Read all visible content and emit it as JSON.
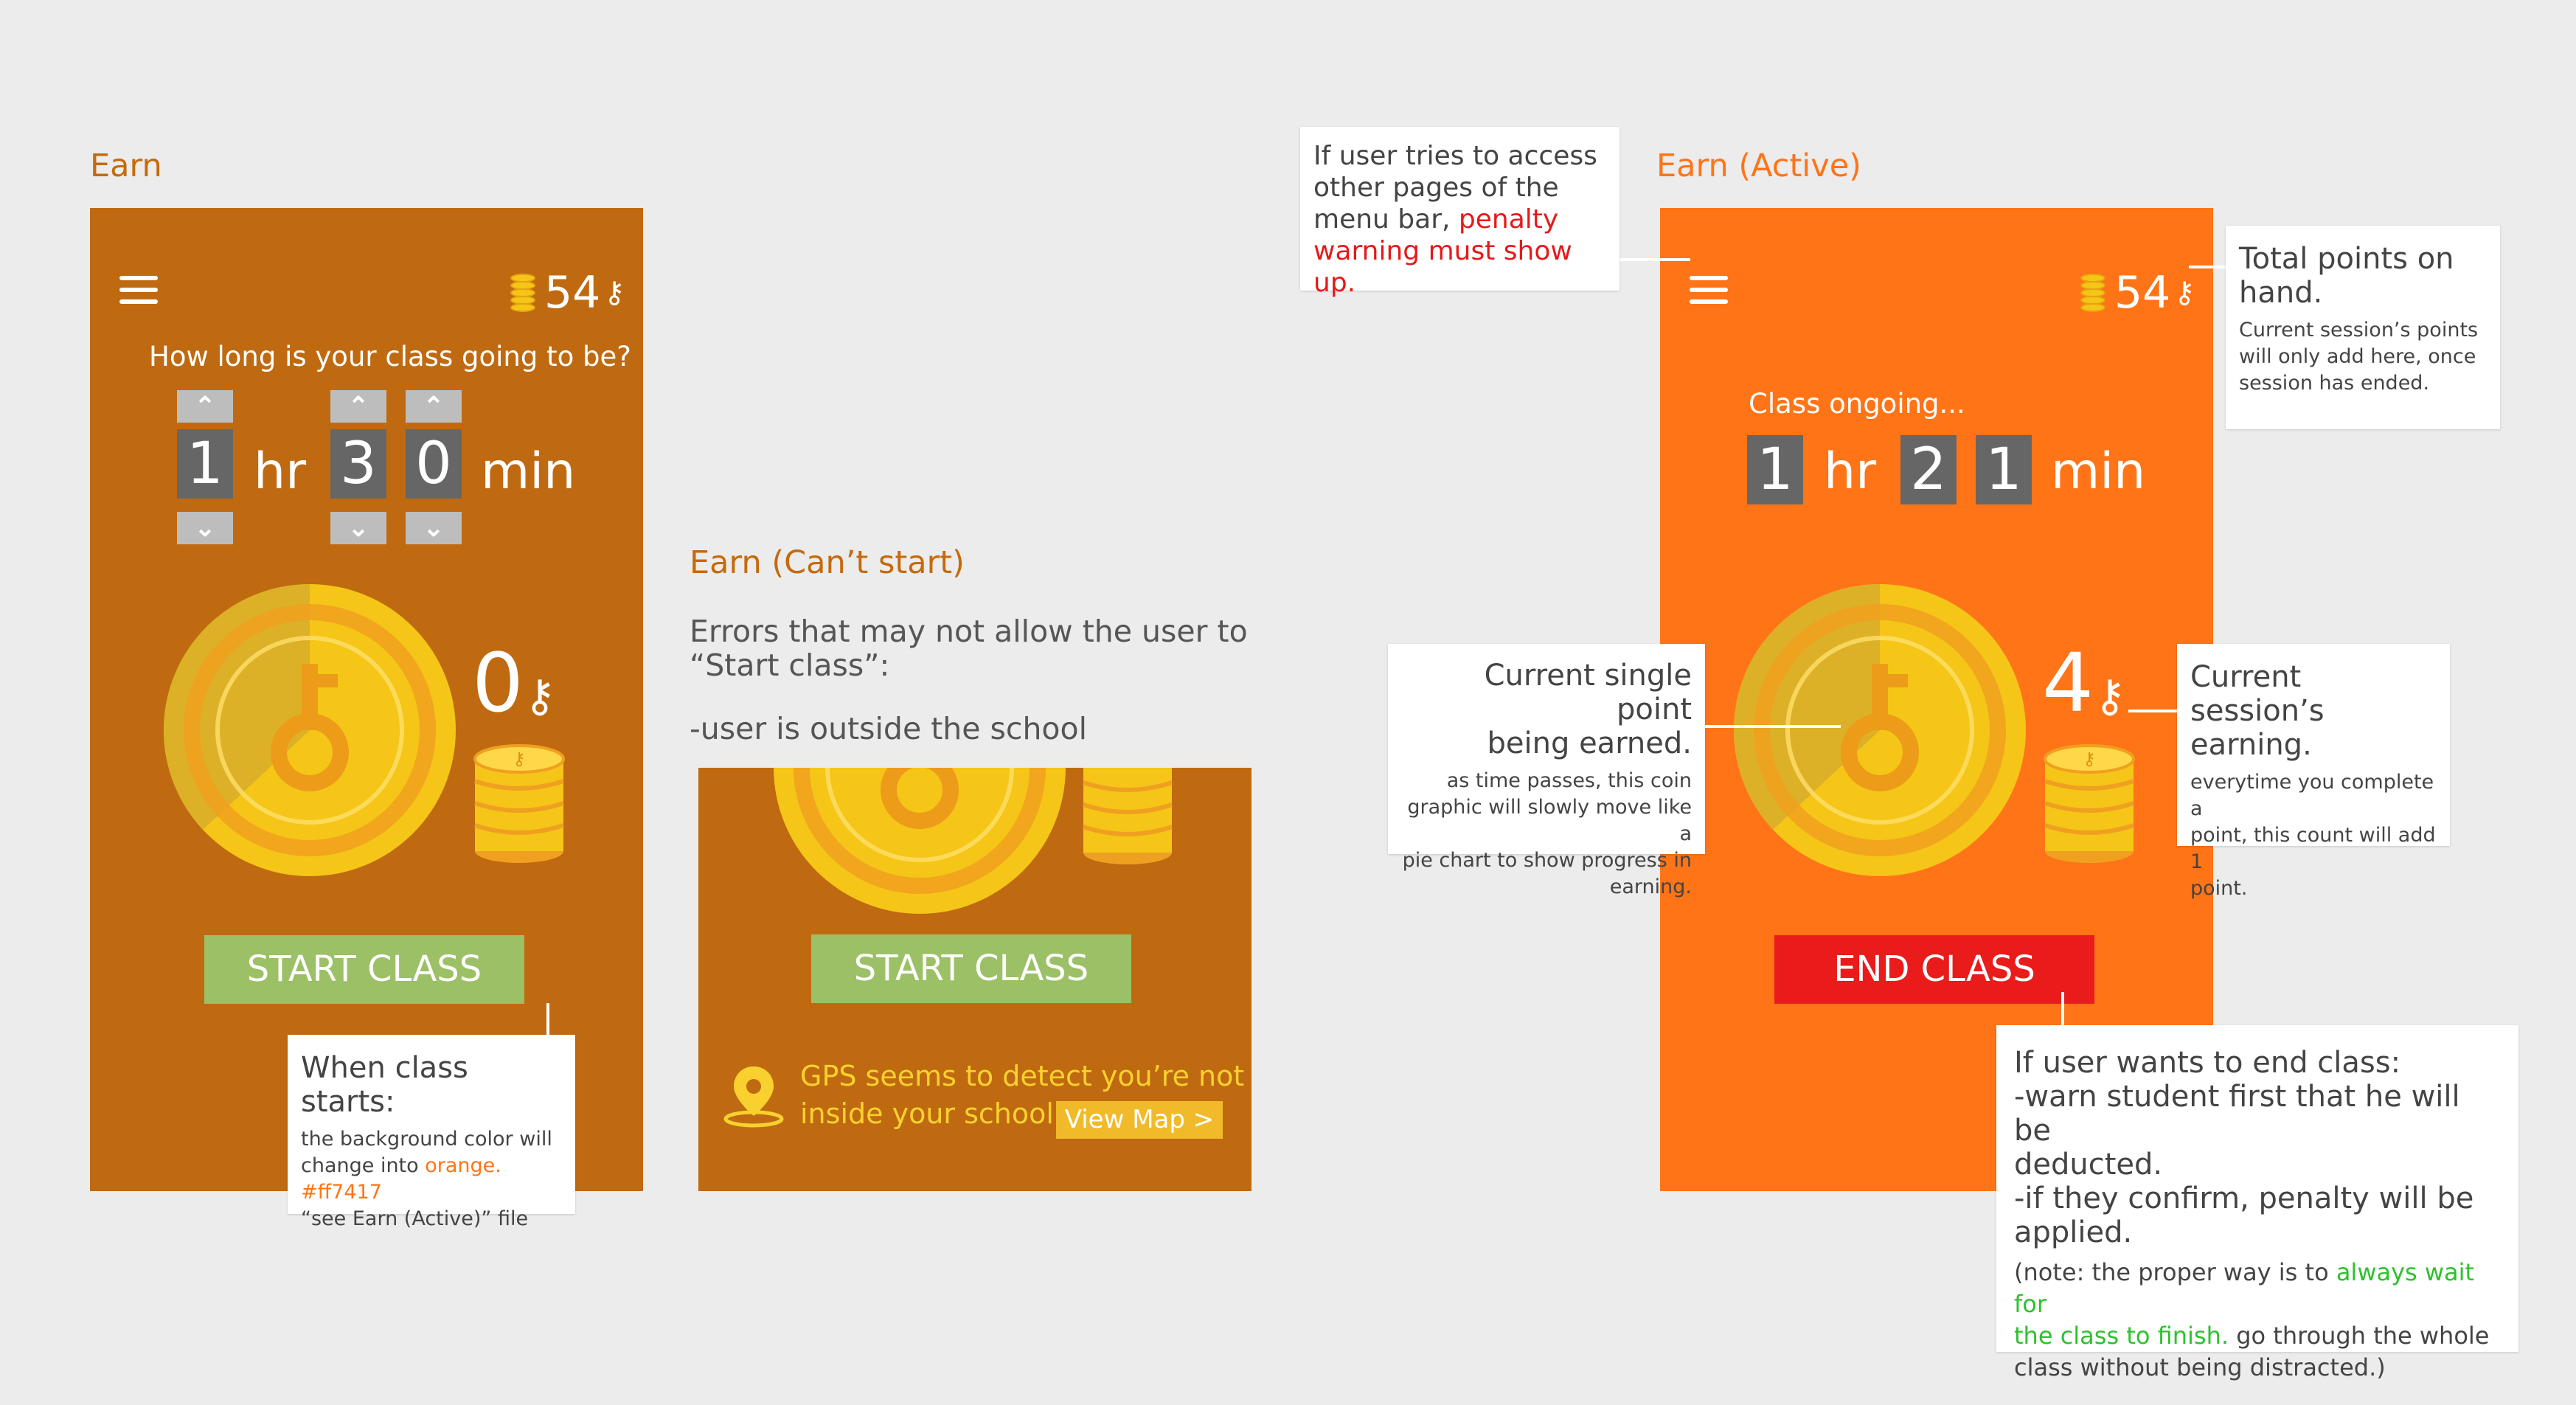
{
  "colors": {
    "earn_bg": "#bf6a11",
    "active_bg": "#ff7417",
    "start_button": "#9bc066",
    "end_button": "#ea1b1b",
    "title_orange": "#c56a0c",
    "title_bright": "#ff7417",
    "highlight_red": "#e51919",
    "highlight_green": "#2ec12e",
    "gps_yellow": "#f9d12e"
  },
  "earn": {
    "title": "Earn",
    "points": "54",
    "question": "How long is your class going to be?",
    "hours_digit": "1",
    "hours_unit": "hr",
    "min_digit_1": "3",
    "min_digit_2": "0",
    "min_unit": "min",
    "session_points": "0",
    "start_button": "START CLASS",
    "icons": [
      "menu-icon",
      "coin-stack-icon",
      "key-icon",
      "chevron-up-icon",
      "chevron-down-icon"
    ]
  },
  "cant_start": {
    "title": "Earn (Can’t start)",
    "desc_line1": "Errors that may not allow the user to",
    "desc_line2": "“Start class”:",
    "desc_line3": "-user is outside the school",
    "start_button": "START CLASS",
    "gps_line1": "GPS seems to detect you’re not",
    "gps_line2": "inside your school.",
    "view_map": "View Map >"
  },
  "active": {
    "title": "Earn (Active)",
    "points": "54",
    "status": "Class ongoing...",
    "hours_digit": "1",
    "hours_unit": "hr",
    "min_digit_1": "2",
    "min_digit_2": "1",
    "min_unit": "min",
    "session_points": "4",
    "end_button": "END CLASS"
  },
  "notes": {
    "class_starts": {
      "heading": "When class starts:",
      "line1": "the background color will",
      "line2_prefix": "change into ",
      "line2_highlight": "orange. #ff7417",
      "line3": "“see Earn (Active)” file"
    },
    "penalty": {
      "line1": "If user tries to access",
      "line2": "other pages of the",
      "line3_prefix": "menu bar, ",
      "line3_highlight": "penalty",
      "line4_highlight": "warning must show up."
    },
    "total_points": {
      "heading1": "Total points on",
      "heading2": "hand.",
      "line1": "Current session’s points",
      "line2": "will only add here, once",
      "line3": "session has ended."
    },
    "single_point": {
      "heading1": "Current single point",
      "heading2": "being earned.",
      "line1": "as time passes, this coin",
      "line2": "graphic will slowly move like a",
      "line3": "pie chart to show progress in",
      "line4": "earning."
    },
    "session_earning": {
      "heading1": "Current session’s",
      "heading2": "earning.",
      "line1": "everytime you complete a",
      "line2": "point, this count will add 1",
      "line3": "point."
    },
    "end_class": {
      "line1": "If user wants to end class:",
      "line2": "-warn student first that he will be",
      "line3": "deducted.",
      "line4": "-if they confirm, penalty will be",
      "line5": "applied.",
      "note1_prefix": "(note: the proper way is to ",
      "note1_highlight": "always wait for",
      "note2_highlight": "the class to finish.",
      "note2_suffix": " go through the whole",
      "note3": "class without being distracted.)"
    }
  }
}
